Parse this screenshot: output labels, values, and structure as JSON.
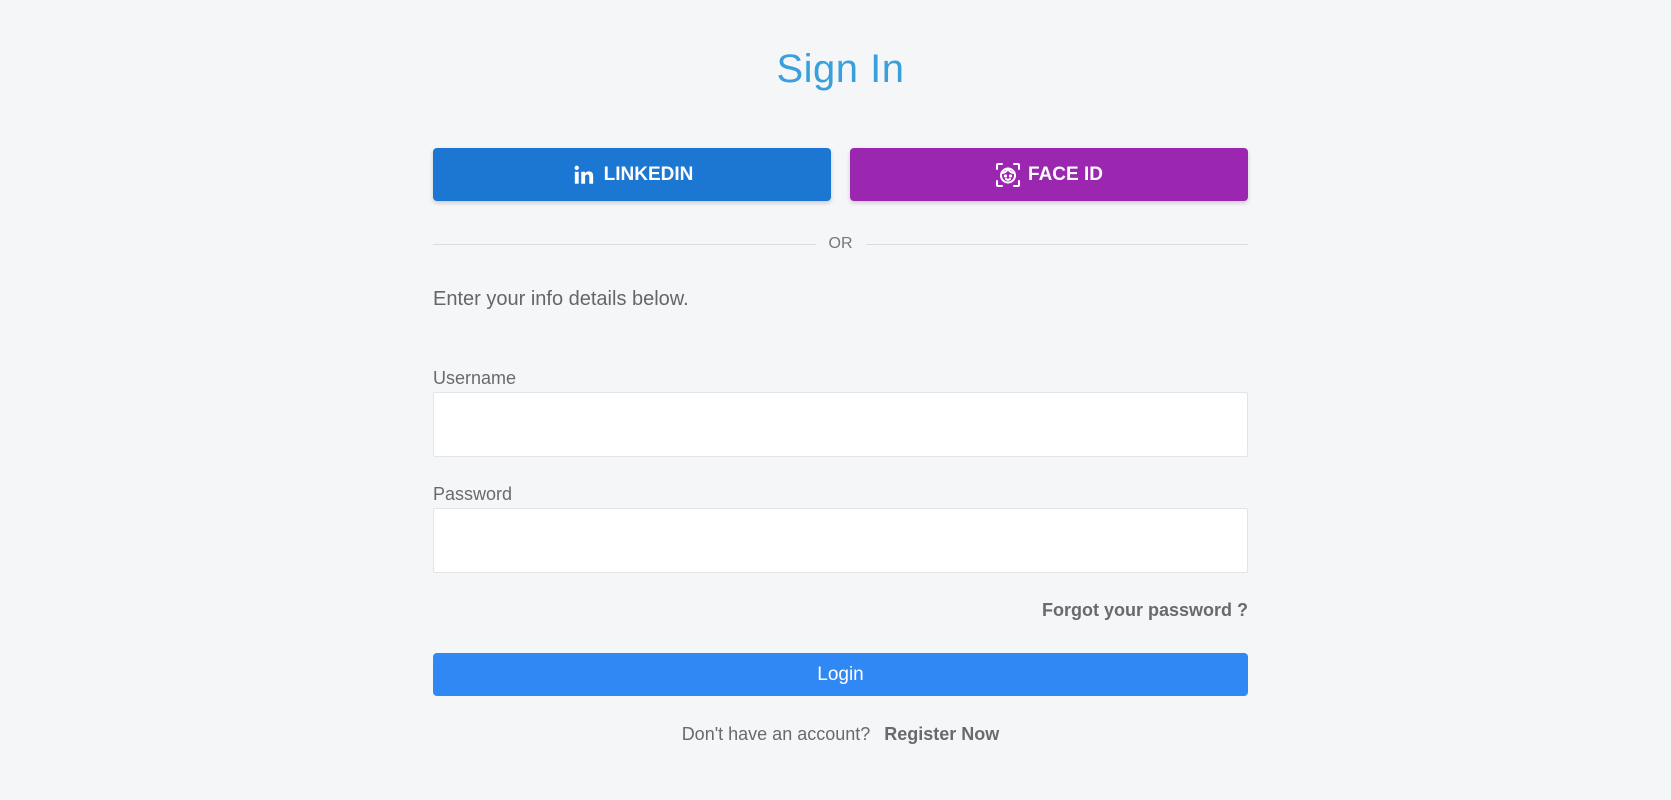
{
  "header": {
    "title": "Sign In"
  },
  "social": {
    "linkedin_label": "LINKEDIN",
    "linkedin_icon": "linkedin-icon",
    "linkedin_color": "#1b77d2",
    "faceid_label": "FACE ID",
    "faceid_icon": "face-id-icon",
    "faceid_color": "#9b27b0"
  },
  "divider": {
    "text": "OR"
  },
  "form": {
    "intro": "Enter your info details below.",
    "username_label": "Username",
    "username_value": "",
    "password_label": "Password",
    "password_value": "",
    "forgot_link": "Forgot your password ?",
    "login_label": "Login",
    "login_color": "#3088f4"
  },
  "footer": {
    "prompt": "Don't have an account?",
    "register_link": "Register Now"
  },
  "colors": {
    "title": "#3aa0dc",
    "background": "#f5f6f8"
  }
}
